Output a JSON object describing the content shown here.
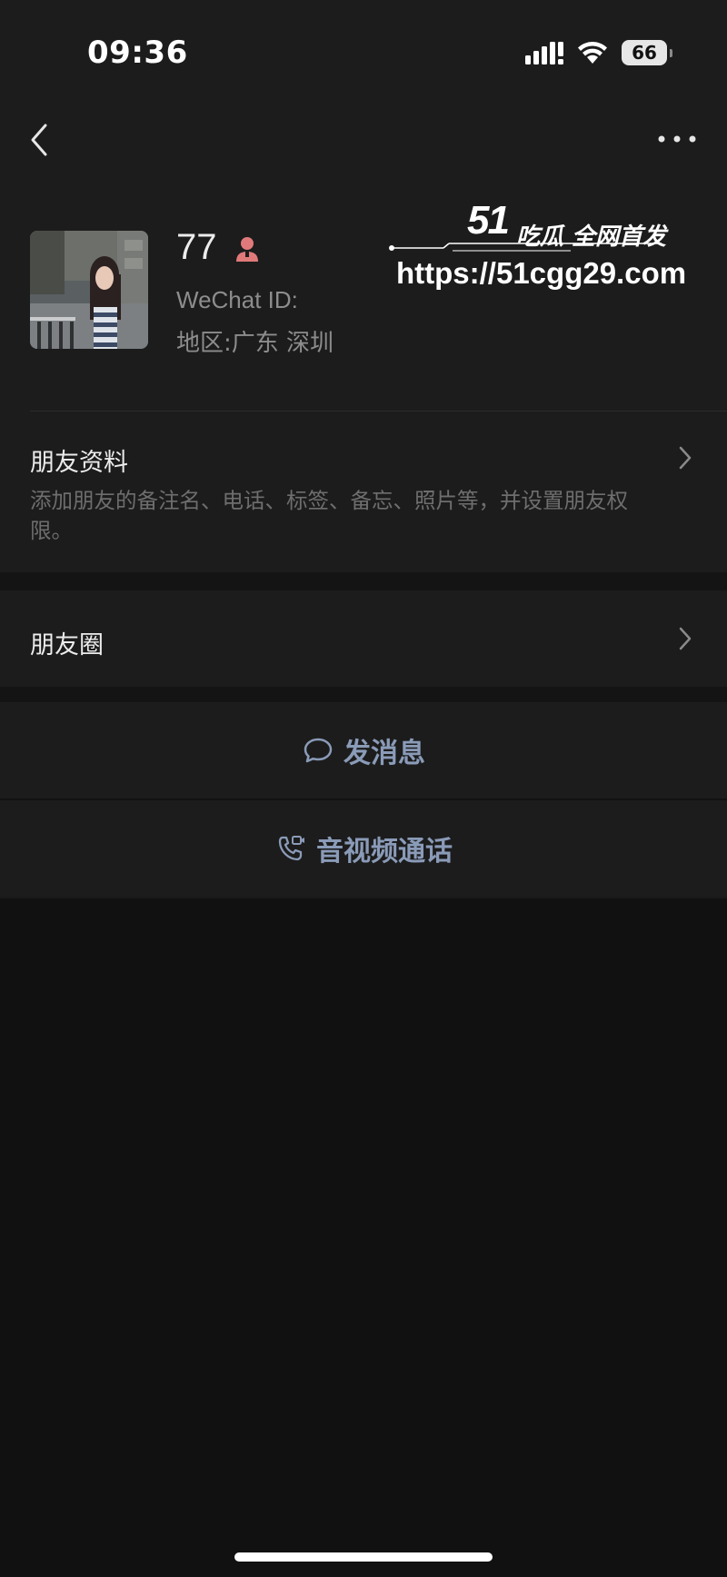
{
  "status_bar": {
    "time": "09:36",
    "battery": "66",
    "icons": [
      "signal-icon",
      "wifi-icon",
      "battery-icon"
    ]
  },
  "nav": {
    "back_icon": "chevron-left-icon",
    "more_icon": "more-horizontal-icon"
  },
  "profile": {
    "name": "77",
    "gender_icon": "female-icon",
    "wechat_id_label": "WeChat ID:",
    "region": "地区:广东 深圳"
  },
  "watermark": {
    "brand": "51",
    "tag": "吃瓜 全网首发",
    "url": "https://51cgg29.com"
  },
  "friend_info": {
    "title": "朋友资料",
    "description": "添加朋友的备注名、电话、标签、备忘、照片等，并设置朋友权限。"
  },
  "moments": {
    "title": "朋友圈"
  },
  "actions": {
    "message_label": "发消息",
    "call_label": "音视频通话"
  },
  "colors": {
    "background": "#111111",
    "panel": "#1c1c1c",
    "action_text": "#8a9bb8",
    "gender_icon": "#e07a7a"
  }
}
